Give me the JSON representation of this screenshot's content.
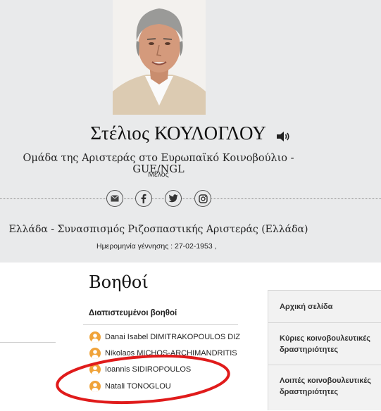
{
  "profile": {
    "name": "Στέλιος ΚΟΥΛΟΓΛΟΥ",
    "group": "Ομάδα της Αριστεράς στο Ευρωπαϊκό Κοινοβούλιο - GUE/NGL",
    "role": "Μέλος",
    "country_party": "Ελλάδα - Συνασπισμός Ριζοσπαστικής Αριστεράς (Ελλάδα)",
    "birth": "Ημερομηνία γέννησης : 27-02-1953 ,"
  },
  "social": [
    "email-icon",
    "facebook-icon",
    "twitter-icon",
    "instagram-icon"
  ],
  "assistants": {
    "title": "Βοηθοί",
    "subtitle": "Διαπιστευμένοι βοηθοί",
    "items": [
      {
        "name": "Danai Isabel DIMITRAKOPOULOS DIZ"
      },
      {
        "name": "Nikolaos MICHOS-ARCHIMANDRITIS"
      },
      {
        "name": "Ioannis SIDIROPOULOS"
      },
      {
        "name": "Natali TONOGLOU"
      }
    ]
  },
  "sidebar": {
    "items": [
      {
        "label_line1": "Αρχική σελίδα",
        "label_line2": ""
      },
      {
        "label_line1": "Κύριες κοινοβουλευτικές",
        "label_line2": "δραστηριότητες"
      },
      {
        "label_line1": "Λοιπές κοινοβουλευτικές",
        "label_line2": "δραστηριότητες"
      }
    ]
  },
  "colors": {
    "header_bg": "#e9eaeb",
    "accent_orange": "#f0a33a",
    "annotation_red": "#e01b1b"
  }
}
